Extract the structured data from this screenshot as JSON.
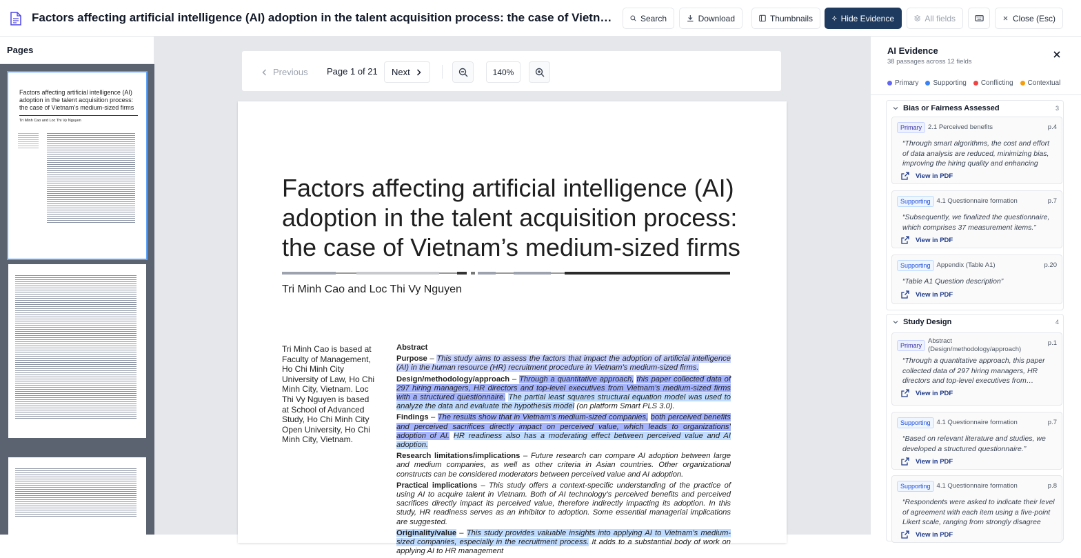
{
  "header": {
    "title": "Factors affecting artificial intelligence (AI) adoption in the talent acquisition process: the case of Vietnam’s mediu...",
    "buttons": {
      "search": "Search",
      "download": "Download",
      "thumbnails": "Thumbnails",
      "hide_evidence": "Hide Evidence",
      "all_fields": "All fields",
      "close": "Close (Esc)"
    }
  },
  "sidebar": {
    "title": "Pages"
  },
  "viewer": {
    "previous": "Previous",
    "page_label": "Page 1 of 21",
    "next": "Next",
    "zoom": "140%"
  },
  "paper": {
    "title": "Factors affecting artificial intelligence (AI) adoption in the talent acquisition process: the case of Vietnam’s medium-sized firms",
    "authors": "Tri Minh Cao and Loc Thi Vy Nguyen",
    "affiliation": "Tri Minh Cao is based at Faculty of Management, Ho Chi Minh City University of Law, Ho Chi Minh City, Vietnam. Loc Thi Vy Nguyen is based at School of Advanced Study, Ho Chi Minh City Open University, Ho Chi Minh City, Vietnam.",
    "abstract_heading": "Abstract",
    "purpose_label": "Purpose",
    "purpose_text": "This study aims to assess the factors that impact the adoption of artificial intelligence (AI) in the human resource (HR) recruitment procedure in Vietnam’s medium-sized firms.",
    "design_label": "Design/methodology/approach",
    "design_text_a": "Through a quantitative approach,",
    "design_text_b": "this paper collected data of 297 hiring managers, HR directors and top-level executives from Vietnam’s medium-sized firms with a structured questionnaire.",
    "design_text_c": "The partial least squares structural equation model was used to analyze the data and evaluate the hypothesis model",
    "design_text_d": "(on platform Smart PLS 3.0).",
    "findings_label": "Findings",
    "findings_text_a": "The results show that in Vietnam’s medium-sized companies,",
    "findings_text_b": "both perceived benefits and perceived sacrifices directly impact on perceived value, which leads to organizations’ adoption of AI.",
    "findings_text_c": "HR readiness also has a moderating effect between perceived value and AI adoption.",
    "limits_label": "Research limitations/implications",
    "limits_text": "Future research can compare AI adoption between large and medium companies, as well as other criteria in Asian countries. Other organizational constructs can be considered moderators between perceived value and AI adoption.",
    "practical_label": "Practical implications",
    "practical_text": "This study offers a context-specific understanding of the practice of using AI to acquire talent in Vietnam. Both of AI technology’s perceived benefits and perceived sacrifices directly impact its perceived value, therefore indirectly impacting its adoption. In this study, HR readiness serves as an inhibitor to adoption. Some essential managerial implications are suggested.",
    "originality_label": "Originality/value",
    "originality_text_a": "This study provides valuable insights into applying AI to Vietnam’s medium-sized companies, especially in the recruitment process.",
    "originality_text_b": "It adds to a substantial body of work on applying AI to HR management"
  },
  "thumb1": {
    "title": "Factors affecting artificial intelligence (AI) adoption in the talent acquisition process: the case of Vietnam’s medium-sized firms",
    "authors": "Tri Minh Cao and Loc Thi Vy Nguyen"
  },
  "evidence": {
    "title": "AI Evidence",
    "subtitle": "38 passages across 12 fields",
    "legend": [
      "Primary",
      "Supporting",
      "Conflicting",
      "Contextual"
    ],
    "legend_colors": [
      "#6366f1",
      "#3b82f6",
      "#ef4444",
      "#f59e0b"
    ],
    "view_label": "View in PDF",
    "groups": [
      {
        "name": "Bias or Fairness Assessed",
        "count": "3",
        "items": [
          {
            "badge": "Primary",
            "section": "2.1 Perceived benefits",
            "page": "p.4",
            "quote": "“Through smart algorithms, the cost and effort of data analysis are reduced, minimizing bias, improving the hiring quality and enhancing the…"
          },
          {
            "badge": "Supporting",
            "section": "4.1 Questionnaire formation",
            "page": "p.7",
            "quote": "“Subsequently, we finalized the questionnaire, which comprises 37 measurement items.”"
          },
          {
            "badge": "Supporting",
            "section": "Appendix (Table A1)",
            "page": "p.20",
            "quote": "“Table A1 Question description”"
          }
        ]
      },
      {
        "name": "Study Design",
        "count": "4",
        "items": [
          {
            "badge": "Primary",
            "section": "Abstract (Design/methodology/approach)",
            "page": "p.1",
            "quote": "“Through a quantitative approach, this paper collected data of 297 hiring managers, HR directors and top-level executives from…"
          },
          {
            "badge": "Supporting",
            "section": "4.1 Questionnaire formation",
            "page": "p.7",
            "quote": "“Based on relevant literature and studies, we developed a structured questionnaire.”"
          },
          {
            "badge": "Supporting",
            "section": "4.1 Questionnaire formation",
            "page": "p.8",
            "quote": "“Respondents were asked to indicate their level of agreement with each item using a five-point Likert scale, ranging from strongly disagree (1)…"
          }
        ]
      }
    ]
  }
}
